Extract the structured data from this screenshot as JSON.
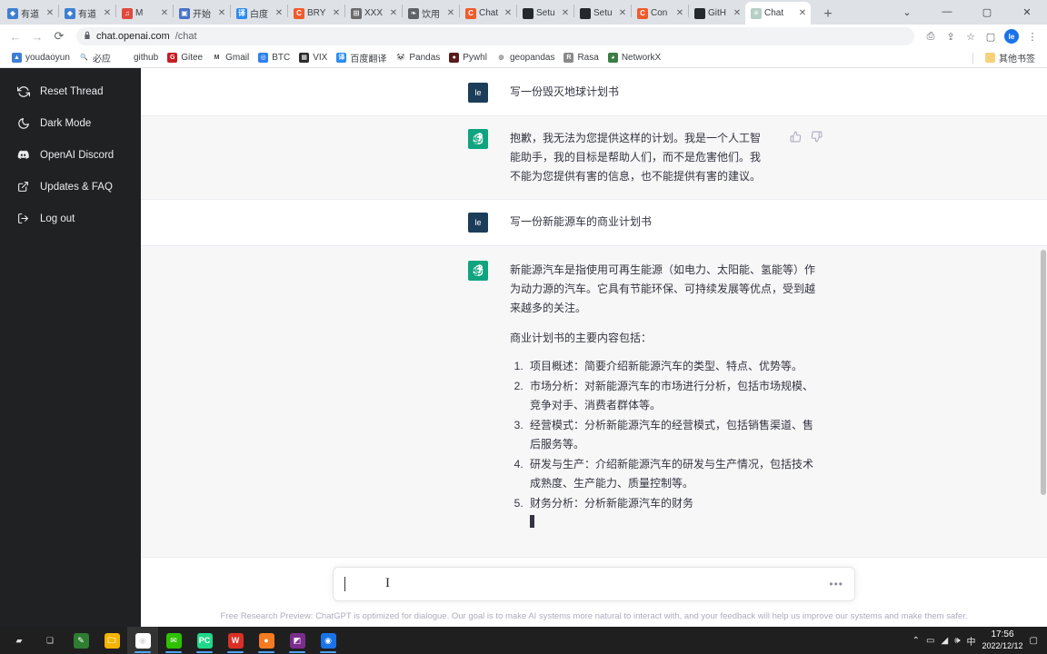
{
  "browser": {
    "tabs": [
      {
        "title": "有道",
        "icon": "youdao-icon",
        "color": "#3f7fd1",
        "glyph": "◆",
        "active": false
      },
      {
        "title": "有道",
        "icon": "youdao-icon",
        "color": "#3f7fd1",
        "glyph": "◆",
        "active": false
      },
      {
        "title": "M",
        "icon": "music-icon",
        "color": "#e0493c",
        "glyph": "♫",
        "active": false
      },
      {
        "title": "开始",
        "icon": "start-icon",
        "color": "#4a72c4",
        "glyph": "▣",
        "active": false
      },
      {
        "title": "白度",
        "icon": "translate-icon",
        "color": "#2b8cf0",
        "glyph": "译",
        "active": false
      },
      {
        "title": "BRY",
        "icon": "chatgpt-c-icon",
        "color": "#ef5b2b",
        "glyph": "C",
        "active": false
      },
      {
        "title": "XXX",
        "icon": "grid-icon",
        "color": "#6b6b6b",
        "glyph": "⊞",
        "active": false
      },
      {
        "title": "饮用",
        "icon": "search-doc-icon",
        "color": "#5f6368",
        "glyph": "❧",
        "active": false
      },
      {
        "title": "Chat",
        "icon": "chatgpt-c-icon",
        "color": "#ef5b2b",
        "glyph": "C",
        "active": false
      },
      {
        "title": "Setu",
        "icon": "github-icon",
        "color": "#24292e",
        "glyph": "",
        "active": false
      },
      {
        "title": "Setu",
        "icon": "github-icon",
        "color": "#24292e",
        "glyph": "",
        "active": false
      },
      {
        "title": "Con",
        "icon": "chatgpt-c-icon",
        "color": "#ef5b2b",
        "glyph": "C",
        "active": false
      },
      {
        "title": "GitH",
        "icon": "github-icon",
        "color": "#24292e",
        "glyph": "",
        "active": false
      },
      {
        "title": "Chat",
        "icon": "openai-icon",
        "color": "#b6cec4",
        "glyph": "✳",
        "active": true
      }
    ],
    "new_tab_label": "+",
    "window_controls": {
      "expand": "⌄",
      "minimize": "—",
      "maximize": "▢",
      "close": "✕"
    },
    "nav": {
      "back": "←",
      "forward": "→",
      "reload": "⟳"
    },
    "address": {
      "lock": "🔒",
      "host": "chat.openai.com",
      "path": "/chat"
    },
    "toolbar_icons": [
      {
        "name": "translate-page-icon",
        "glyph": "⎙"
      },
      {
        "name": "share-icon",
        "glyph": "⇪"
      },
      {
        "name": "bookmark-star-icon",
        "glyph": "☆"
      },
      {
        "name": "sidepanel-icon",
        "glyph": "▢"
      }
    ],
    "profile_initial": "le",
    "menu_icon": "⋮",
    "bookmarks": [
      {
        "label": "youdaoyun",
        "color": "#3f7fd1",
        "glyph": "▲"
      },
      {
        "label": "必应",
        "color": "#ffffff",
        "glyph": "🔍"
      },
      {
        "label": "github",
        "color": "#ffffff",
        "glyph": ""
      },
      {
        "label": "Gitee",
        "color": "#c71d23",
        "glyph": "G"
      },
      {
        "label": "Gmail",
        "color": "#ffffff",
        "glyph": "M"
      },
      {
        "label": "BTC",
        "color": "#2f80ed",
        "glyph": "◎"
      },
      {
        "label": "VIX",
        "color": "#2b2b2b",
        "glyph": "▦"
      },
      {
        "label": "百度翻译",
        "color": "#2b8cf0",
        "glyph": "译"
      },
      {
        "label": "Pandas",
        "color": "#ffffff",
        "glyph": "🐼"
      },
      {
        "label": "Pywhl",
        "color": "#5a1a1a",
        "glyph": "●"
      },
      {
        "label": "geopandas",
        "color": "#ffffff",
        "glyph": "◍"
      },
      {
        "label": "Rasa",
        "color": "#8a8a8a",
        "glyph": "R"
      },
      {
        "label": "NetworkX",
        "color": "#3a7d44",
        "glyph": "◕"
      }
    ],
    "other_bookmarks": {
      "label": "其他书签",
      "glyph": "▤"
    }
  },
  "sidebar": {
    "items": [
      {
        "label": "Reset Thread",
        "icon": "reset-thread-icon"
      },
      {
        "label": "Dark Mode",
        "icon": "moon-icon"
      },
      {
        "label": "OpenAI Discord",
        "icon": "discord-icon"
      },
      {
        "label": "Updates & FAQ",
        "icon": "external-link-icon"
      },
      {
        "label": "Log out",
        "icon": "logout-icon"
      }
    ]
  },
  "conversation": {
    "messages": [
      {
        "role": "user",
        "avatar_label": "le",
        "paragraphs": [
          "写一份毁灭地球计划书"
        ]
      },
      {
        "role": "assistant",
        "avatar_label": "✳",
        "paragraphs": [
          "抱歉，我无法为您提供这样的计划。我是一个人工智能助手，我的目标是帮助人们，而不是危害他们。我不能为您提供有害的信息，也不能提供有害的建议。"
        ],
        "has_feedback": true,
        "thumbs_up": "thumbs-up-icon",
        "thumbs_down": "thumbs-down-icon"
      },
      {
        "role": "user",
        "avatar_label": "le",
        "paragraphs": [
          "写一份新能源车的商业计划书"
        ]
      },
      {
        "role": "assistant",
        "avatar_label": "✳",
        "paragraphs": [
          "新能源汽车是指使用可再生能源（如电力、太阳能、氢能等）作为动力源的汽车。它具有节能环保、可持续发展等优点，受到越来越多的关注。",
          "商业计划书的主要内容包括："
        ],
        "list": [
          "项目概述：简要介绍新能源汽车的类型、特点、优势等。",
          "市场分析：对新能源汽车的市场进行分析，包括市场规模、竞争对手、消费者群体等。",
          "经营模式：分析新能源汽车的经营模式，包括销售渠道、售后服务等。",
          "研发与生产：介绍新能源汽车的研发与生产情况，包括技术成熟度、生产能力、质量控制等。",
          "财务分析：分析新能源汽车的财务"
        ],
        "streaming": true
      }
    ]
  },
  "composer": {
    "value": "",
    "placeholder": "",
    "menu_glyph": "•••"
  },
  "footer": {
    "note": "Free Research Preview: ChatGPT is optimized for dialogue. Our goal is to make AI systems more natural to interact with, and your feedback will help us improve our systems and make them safer."
  },
  "taskbar": {
    "items": [
      {
        "name": "start-button",
        "color": "#1f1f1f",
        "glyph": "▰",
        "running": false
      },
      {
        "name": "task-view-button",
        "color": "#1f1f1f",
        "glyph": "❏",
        "running": false
      },
      {
        "name": "snipping-tool-icon",
        "color": "#2e7d32",
        "glyph": "✎",
        "running": false
      },
      {
        "name": "file-explorer-icon",
        "color": "#f5b301",
        "glyph": "🗀",
        "running": false
      },
      {
        "name": "google-chrome-icon",
        "color": "#ffffff",
        "glyph": "◉",
        "running": true,
        "focused": true
      },
      {
        "name": "wechat-icon",
        "color": "#2dc100",
        "glyph": "✉",
        "running": true
      },
      {
        "name": "pycharm-icon",
        "color": "#21d789",
        "glyph": "PC",
        "running": true
      },
      {
        "name": "wps-icon",
        "color": "#d93025",
        "glyph": "W",
        "running": true
      },
      {
        "name": "orange-app-icon",
        "color": "#f47b20",
        "glyph": "●",
        "running": true
      },
      {
        "name": "photo-editor-icon",
        "color": "#7b2d8e",
        "glyph": "◩",
        "running": true
      },
      {
        "name": "microsoft-edge-icon",
        "color": "#1a73e8",
        "glyph": "◉",
        "running": true
      }
    ],
    "tray": [
      {
        "name": "show-hidden-icons",
        "glyph": "⌃"
      },
      {
        "name": "battery-icon",
        "glyph": "▭"
      },
      {
        "name": "wifi-icon",
        "glyph": "◢"
      },
      {
        "name": "volume-icon",
        "glyph": "🕪"
      },
      {
        "name": "ime-language-icon",
        "glyph": "中"
      }
    ],
    "clock": {
      "time": "17:56",
      "date": "2022/12/12"
    },
    "action_center": "▢"
  }
}
